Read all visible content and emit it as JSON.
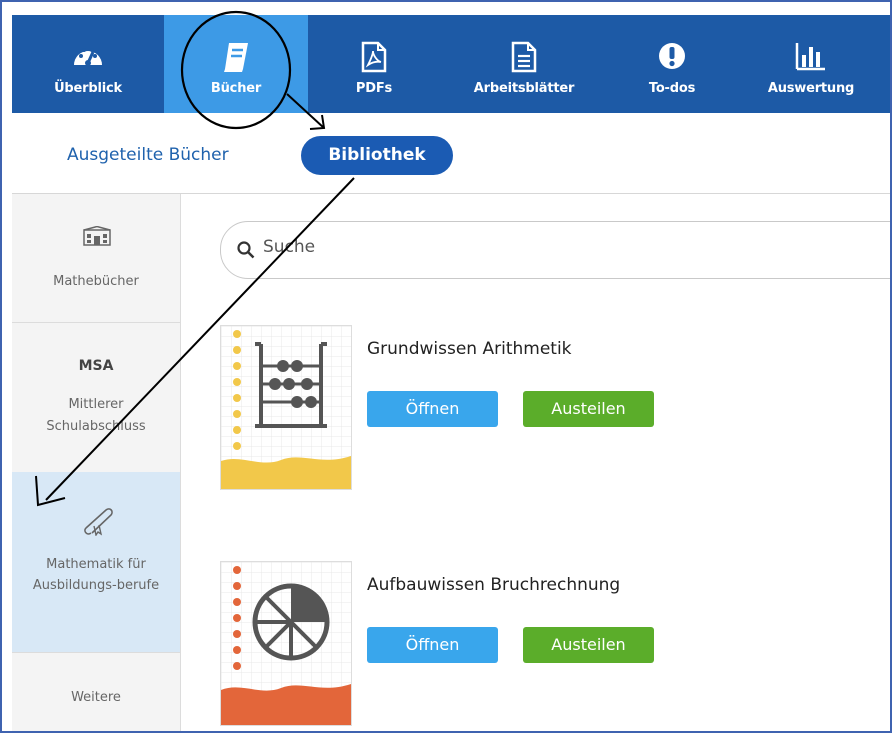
{
  "topnav": {
    "items": [
      {
        "label": "Überblick",
        "icon": "dashboard-icon"
      },
      {
        "label": "Bücher",
        "icon": "book-icon"
      },
      {
        "label": "PDFs",
        "icon": "pdf-icon"
      },
      {
        "label": "Arbeitsblätter",
        "icon": "document-icon"
      },
      {
        "label": "To-dos",
        "icon": "alert-icon"
      },
      {
        "label": "Auswertung",
        "icon": "bar-chart-icon"
      }
    ]
  },
  "subnav": {
    "link": "Ausgeteilte Bücher",
    "active": "Bibliothek"
  },
  "sidebar": {
    "items": [
      {
        "label": "Mathebücher",
        "icon": "school-building-icon"
      },
      {
        "title": "MSA",
        "label": "Mittlerer Schulabschluss"
      },
      {
        "label": "Mathematik für Ausbildungs-berufe",
        "icon": "diploma-icon"
      },
      {
        "label": "Weitere"
      }
    ]
  },
  "search": {
    "placeholder": "Suche"
  },
  "books": [
    {
      "title": "Grundwissen Arithmetik",
      "open_label": "Öffnen",
      "share_label": "Austeilen",
      "cover_color": "#f2c84a"
    },
    {
      "title": "Aufbauwissen Bruchrechnung",
      "open_label": "Öffnen",
      "share_label": "Austeilen",
      "cover_color": "#e3663a"
    }
  ],
  "colors": {
    "nav_bg": "#1d5aa6",
    "nav_active": "#3d9ae6",
    "pill": "#1b5bb3",
    "open_button": "#39a6ec",
    "share_button": "#5bad2a"
  }
}
